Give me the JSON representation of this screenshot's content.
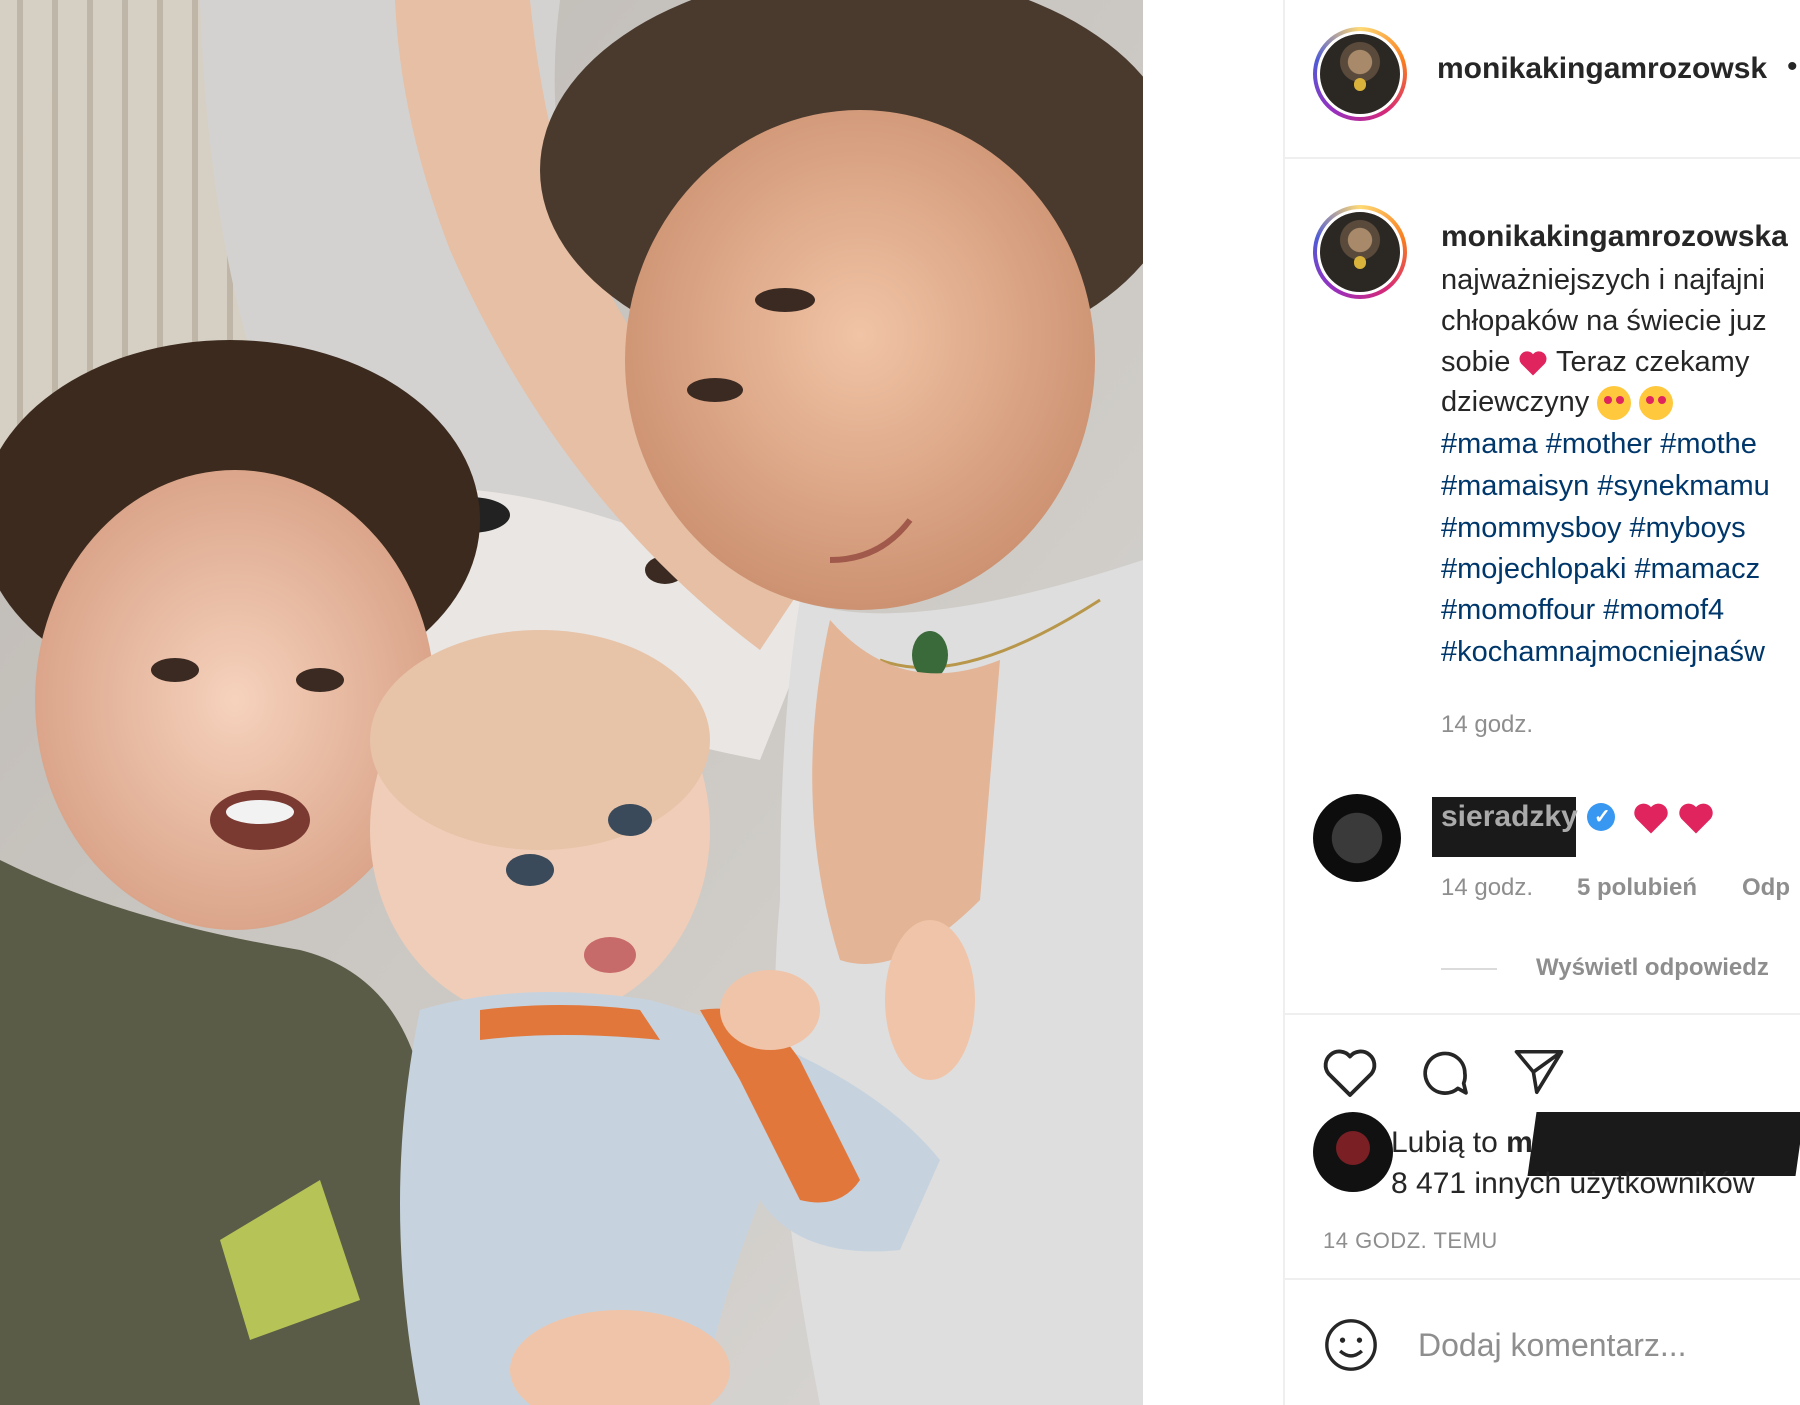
{
  "post": {
    "author_header": "monikakingamrozowsk",
    "header_separator": "•",
    "caption": {
      "author": "monikakingamrozowska",
      "lines": [
        "najważniejszych i najfajni",
        "chłopaków na świecie juz",
        "sobie",
        "Teraz czekamy",
        "dziewczyny"
      ],
      "hashtags": [
        "#mama #mother #mothe",
        "#mamaisyn #synekmamu",
        "#mommysboy #myboys",
        "#mojechlopaki #mamacz",
        "#momoffour #momof4",
        "#kochamnajmocniejnaśw"
      ],
      "time": "14 godz."
    },
    "comment": {
      "author": "sieradzky",
      "time": "14 godz.",
      "likes": "5 polubień",
      "reply": "Odp",
      "view_replies": "Wyświetl odpowiedz"
    },
    "likes": {
      "prefix": "Lubią to",
      "liker": "manufaktura_splot",
      "others": "8 471 innych użytkowników"
    },
    "time_ago": "14 GODZ. TEMU",
    "add_comment_placeholder": "Dodaj komentarz..."
  },
  "colors": {
    "text": "#262626",
    "muted": "#8e8e8e",
    "hashtag": "#00376b",
    "heart": "#e0245e",
    "verified": "#3897f0"
  }
}
